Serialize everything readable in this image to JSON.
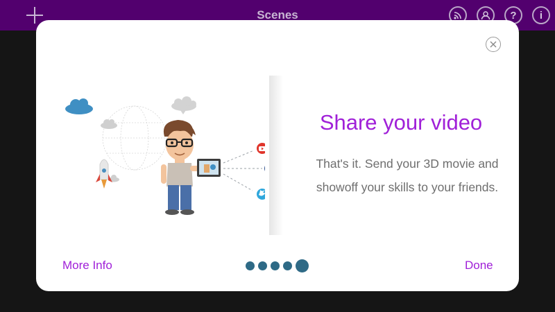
{
  "topbar": {
    "title": "Scenes",
    "icons": [
      "add-icon",
      "broadcast-icon",
      "account-icon",
      "help-icon",
      "info-icon"
    ],
    "color": "#52006e"
  },
  "modal": {
    "heading": "Share your video",
    "body_line1": "That's it. Send your 3D movie and",
    "body_line2": "showoff your skills to your friends.",
    "more_info_label": "More Info",
    "done_label": "Done",
    "accent_color": "#a020d8",
    "pager": {
      "count": 5,
      "active_index": 4
    },
    "illustration_icons": [
      "youtube-icon",
      "facebook-icon",
      "twitter-icon",
      "rocket-icon",
      "cloud-icon",
      "tablet-icon"
    ]
  }
}
